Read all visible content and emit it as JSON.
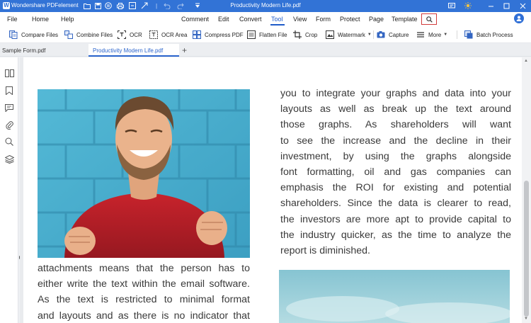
{
  "titlebar": {
    "app_title": "Wondershare PDFelement",
    "doc_title": "Productivity Modern Life.pdf"
  },
  "menu": {
    "items": [
      "File",
      "Home",
      "Help",
      "Comment",
      "Edit",
      "Convert",
      "Tool",
      "View",
      "Form",
      "Protect",
      "Page",
      "Template"
    ],
    "active": "Tool"
  },
  "toolbar": {
    "compare_files": "Compare Files",
    "combine_files": "Combine Files",
    "ocr": "OCR",
    "ocr_area": "OCR Area",
    "compress_pdf": "Compress PDF",
    "flatten_file": "Flatten File",
    "crop": "Crop",
    "watermark": "Watermark",
    "capture": "Capture",
    "more": "More",
    "batch_process": "Batch Process"
  },
  "tabs": [
    "Sample Form.pdf",
    "Productivity Modern Life.pdf"
  ],
  "active_tab": "Productivity Modern Life.pdf",
  "document": {
    "right_column_lines": [
      "you to integrate your graphs and data into your",
      "layouts as well as break up the text around",
      "those graphs. As shareholders will want",
      "to see the increase and the decline in their",
      "investment, by using the graphs alongside",
      "font formatting, oil and gas companies can",
      "emphasis the ROI for existing and potential",
      "shareholders. Since the data is clearer to read,",
      "the investors are more apt to provide capital to",
      "the industry quicker, as the time to analyze the",
      "report is diminished."
    ],
    "left_column_lines": [
      "attachments means that the person has to",
      "either write the text within the email software.",
      "As the text is restricted to minimal format",
      "and layouts and as there is no indicator that"
    ]
  },
  "colors": {
    "accent": "#3273d6",
    "search_highlight": "#d23b3b",
    "active_tab_text": "#2b64cc"
  }
}
